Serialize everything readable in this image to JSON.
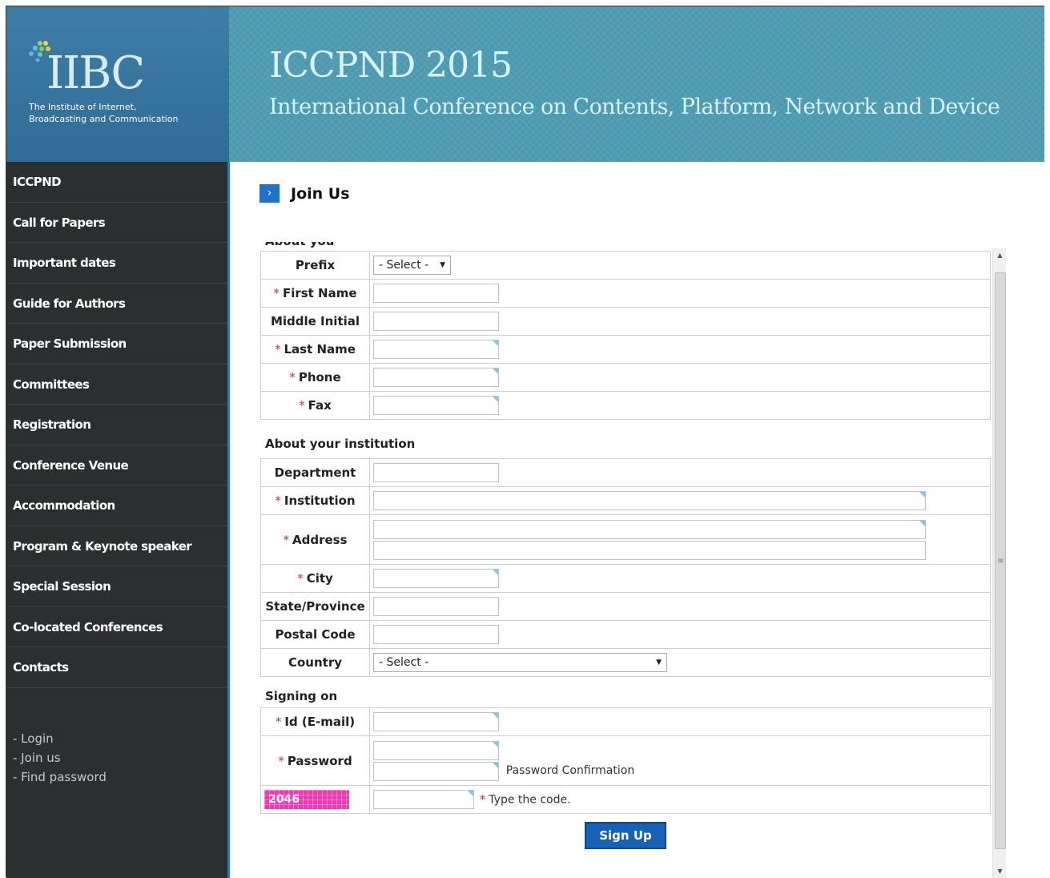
{
  "header": {
    "logo_text": "IIBC",
    "logo_sub_line1": "The Institute of Internet,",
    "logo_sub_line2": "Broadcasting and Communication",
    "title": "ICCPND 2015",
    "subtitle": "International Conference on Contents, Platform, Network and Device"
  },
  "sidebar": {
    "items": [
      {
        "label": "ICCPND"
      },
      {
        "label": "Call for Papers"
      },
      {
        "label": "Important dates"
      },
      {
        "label": "Guide for Authors"
      },
      {
        "label": "Paper Submission"
      },
      {
        "label": "Committees"
      },
      {
        "label": "Registration"
      },
      {
        "label": "Conference Venue"
      },
      {
        "label": "Accommodation"
      },
      {
        "label": "Program & Keynote speaker"
      },
      {
        "label": "Special Session"
      },
      {
        "label": "Co-located Conferences"
      },
      {
        "label": "Contacts"
      }
    ],
    "links": {
      "login": "- Login",
      "join": "- Join us",
      "find_password": "- Find password"
    }
  },
  "main": {
    "title": "Join Us",
    "title_icon": "chevron-right-icon",
    "section_about_you": "About you",
    "section_institution": "About your institution",
    "section_signing": "Signing on",
    "required_mark": "*",
    "fields": {
      "prefix": "Prefix",
      "prefix_value": "- Select -",
      "first_name": "First Name",
      "middle_initial": "Middle Initial",
      "last_name": "Last Name",
      "phone": "Phone",
      "fax": "Fax",
      "department": "Department",
      "institution": "Institution",
      "address": "Address",
      "city": "City",
      "state": "State/Province",
      "postal": "Postal Code",
      "country": "Country",
      "country_value": "- Select -",
      "id": "Id (E-mail)",
      "password": "Password",
      "password_confirm_hint": "Password Confirmation",
      "captcha_code": "2046",
      "captcha_hint": "Type the code."
    },
    "signup_label": "Sign Up"
  },
  "colors": {
    "sidebar_bg": "#2b2f2f",
    "banner_bg": "#4f9db2",
    "accent_blue": "#1f72c7",
    "required_red": "#d23131",
    "captcha_pink": "#ff2fb6"
  }
}
